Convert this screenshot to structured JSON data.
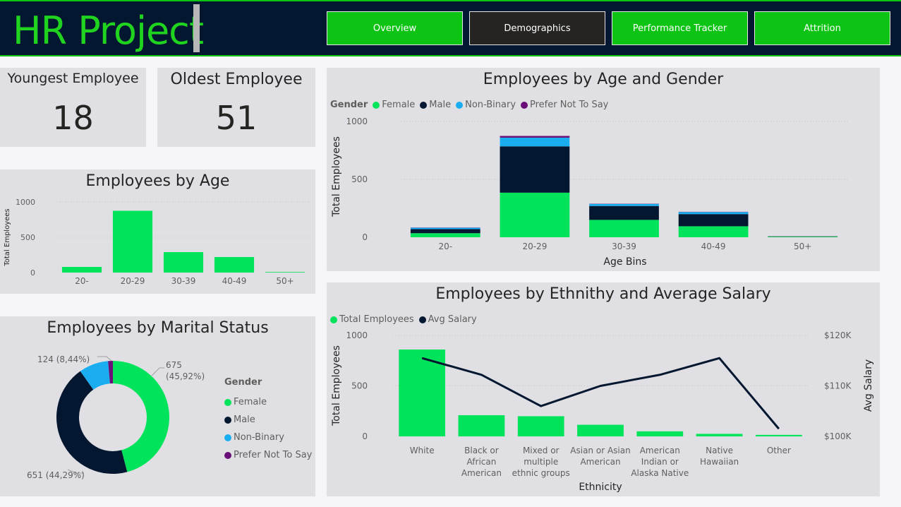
{
  "header": {
    "title": "HR Project",
    "nav": [
      {
        "label": "Overview",
        "active": false
      },
      {
        "label": "Demographics",
        "active": true
      },
      {
        "label": "Performance Tracker",
        "active": false
      },
      {
        "label": "Attrition",
        "active": false
      }
    ]
  },
  "colors": {
    "female": "#00e35a",
    "male": "#041730",
    "non_binary": "#1aaef0",
    "prefer_not": "#6b0f78",
    "header_bg": "#041730",
    "accent": "#0dc414"
  },
  "kpis": {
    "youngest_label": "Youngest Employee",
    "youngest_value": "18",
    "oldest_label": "Oldest Employee",
    "oldest_value": "51"
  },
  "age_chart": {
    "title": "Employees by Age",
    "ylabel": "Total Employees",
    "yticks": [
      "0",
      "500",
      "1000"
    ]
  },
  "marital_chart": {
    "title": "Employees by Marital Status",
    "legend_title": "Gender",
    "labels": {
      "top_right_count": "675",
      "top_right_pct": "(45,92%)",
      "top_left": "124 (8,44%)",
      "bottom_left": "651 (44,29%)"
    }
  },
  "age_gender_chart": {
    "title": "Employees by Age and Gender",
    "legend_title": "Gender",
    "ylabel": "Total Employees",
    "xlabel": "Age Bins",
    "yticks": [
      "0",
      "500",
      "1000"
    ]
  },
  "ethnicity_chart": {
    "title": "Employees by Ethnithy and Average Salary",
    "legend": [
      "Total Employees",
      "Avg Salary"
    ],
    "ylabel": "Total Employees",
    "y2label": "Avg Salary",
    "xlabel": "Ethnicity",
    "yticks": [
      "0",
      "500",
      "1000"
    ],
    "y2ticks": [
      "$100K",
      "$110K",
      "$120K"
    ]
  },
  "chart_data": [
    {
      "type": "bar",
      "title": "Employees by Age",
      "categories": [
        "20-",
        "20-29",
        "30-39",
        "40-49",
        "50+"
      ],
      "values": [
        80,
        875,
        290,
        220,
        8
      ],
      "ylabel": "Total Employees",
      "ylim": [
        0,
        1000
      ]
    },
    {
      "type": "pie",
      "title": "Employees by Marital Status",
      "legend_title": "Gender",
      "categories": [
        "Female",
        "Male",
        "Non-Binary",
        "Prefer Not To Say"
      ],
      "values": [
        675,
        651,
        124,
        20
      ]
    },
    {
      "type": "bar",
      "stacked": true,
      "title": "Employees by Age and Gender",
      "categories": [
        "20-",
        "20-29",
        "30-39",
        "40-49",
        "50+"
      ],
      "series": [
        {
          "name": "Female",
          "values": [
            35,
            385,
            150,
            95,
            5
          ]
        },
        {
          "name": "Male",
          "values": [
            35,
            400,
            120,
            105,
            3
          ]
        },
        {
          "name": "Non-Binary",
          "values": [
            12,
            75,
            18,
            18,
            0
          ]
        },
        {
          "name": "Prefer Not To Say",
          "values": [
            2,
            15,
            2,
            2,
            0
          ]
        }
      ],
      "xlabel": "Age Bins",
      "ylabel": "Total Employees",
      "ylim": [
        0,
        1000
      ]
    },
    {
      "type": "bar",
      "title": "Employees by Ethnithy and Average Salary",
      "categories": [
        "White",
        "Black or African American",
        "Mixed or multiple ethnic groups",
        "Asian or Asian American",
        "American Indian or Alaska Native",
        "Native Hawaiian",
        "Other"
      ],
      "category_lines": [
        [
          "White"
        ],
        [
          "Black or",
          "African",
          "American"
        ],
        [
          "Mixed or",
          "multiple",
          "ethnic groups"
        ],
        [
          "Asian or Asian",
          "American"
        ],
        [
          "American",
          "Indian or",
          "Alaska Native"
        ],
        [
          "Native",
          "Hawaiian"
        ],
        [
          "Other"
        ]
      ],
      "series": [
        {
          "name": "Total Employees",
          "type": "bar",
          "axis": "left",
          "values": [
            860,
            210,
            200,
            115,
            50,
            25,
            15
          ]
        },
        {
          "name": "Avg Salary",
          "type": "line",
          "axis": "right",
          "values": [
            115500,
            112200,
            106000,
            110000,
            112200,
            115500,
            101500
          ]
        }
      ],
      "xlabel": "Ethnicity",
      "ylabel": "Total Employees",
      "y2label": "Avg Salary",
      "ylim": [
        0,
        1000
      ],
      "y2lim": [
        100000,
        120000
      ]
    }
  ]
}
